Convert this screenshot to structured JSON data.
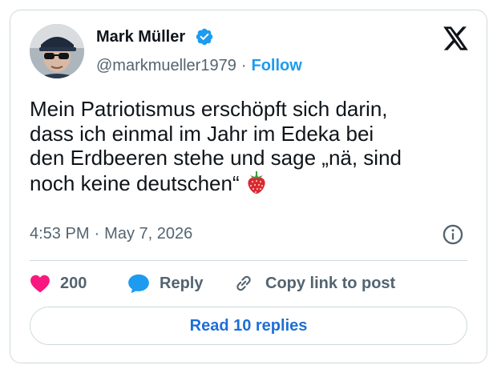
{
  "author": {
    "display_name": "Mark Müller",
    "handle": "@markmueller1979",
    "separator": "·",
    "follow_label": "Follow"
  },
  "tweet": {
    "line1": "Mein Patriotismus erschöpft sich darin,",
    "line2": "dass ich einmal im Jahr im Edeka bei",
    "line3": "den Erdbeeren stehe und sage „nä, sind",
    "line4": "noch keine deutschen“",
    "time": "4:53 PM",
    "separator": "·",
    "date": "May 7, 2026"
  },
  "actions": {
    "like_count": "200",
    "reply_label": "Reply",
    "copy_label": "Copy link to post",
    "read_replies_label": "Read 10 replies"
  },
  "colors": {
    "accent": "#1d9bf0",
    "like": "#f91880",
    "muted": "#536471",
    "border": "#cfd9de"
  },
  "icons": [
    "verified-badge-icon",
    "x-logo-icon",
    "strawberry-emoji-icon",
    "info-icon",
    "heart-icon",
    "reply-bubble-icon",
    "link-icon"
  ]
}
